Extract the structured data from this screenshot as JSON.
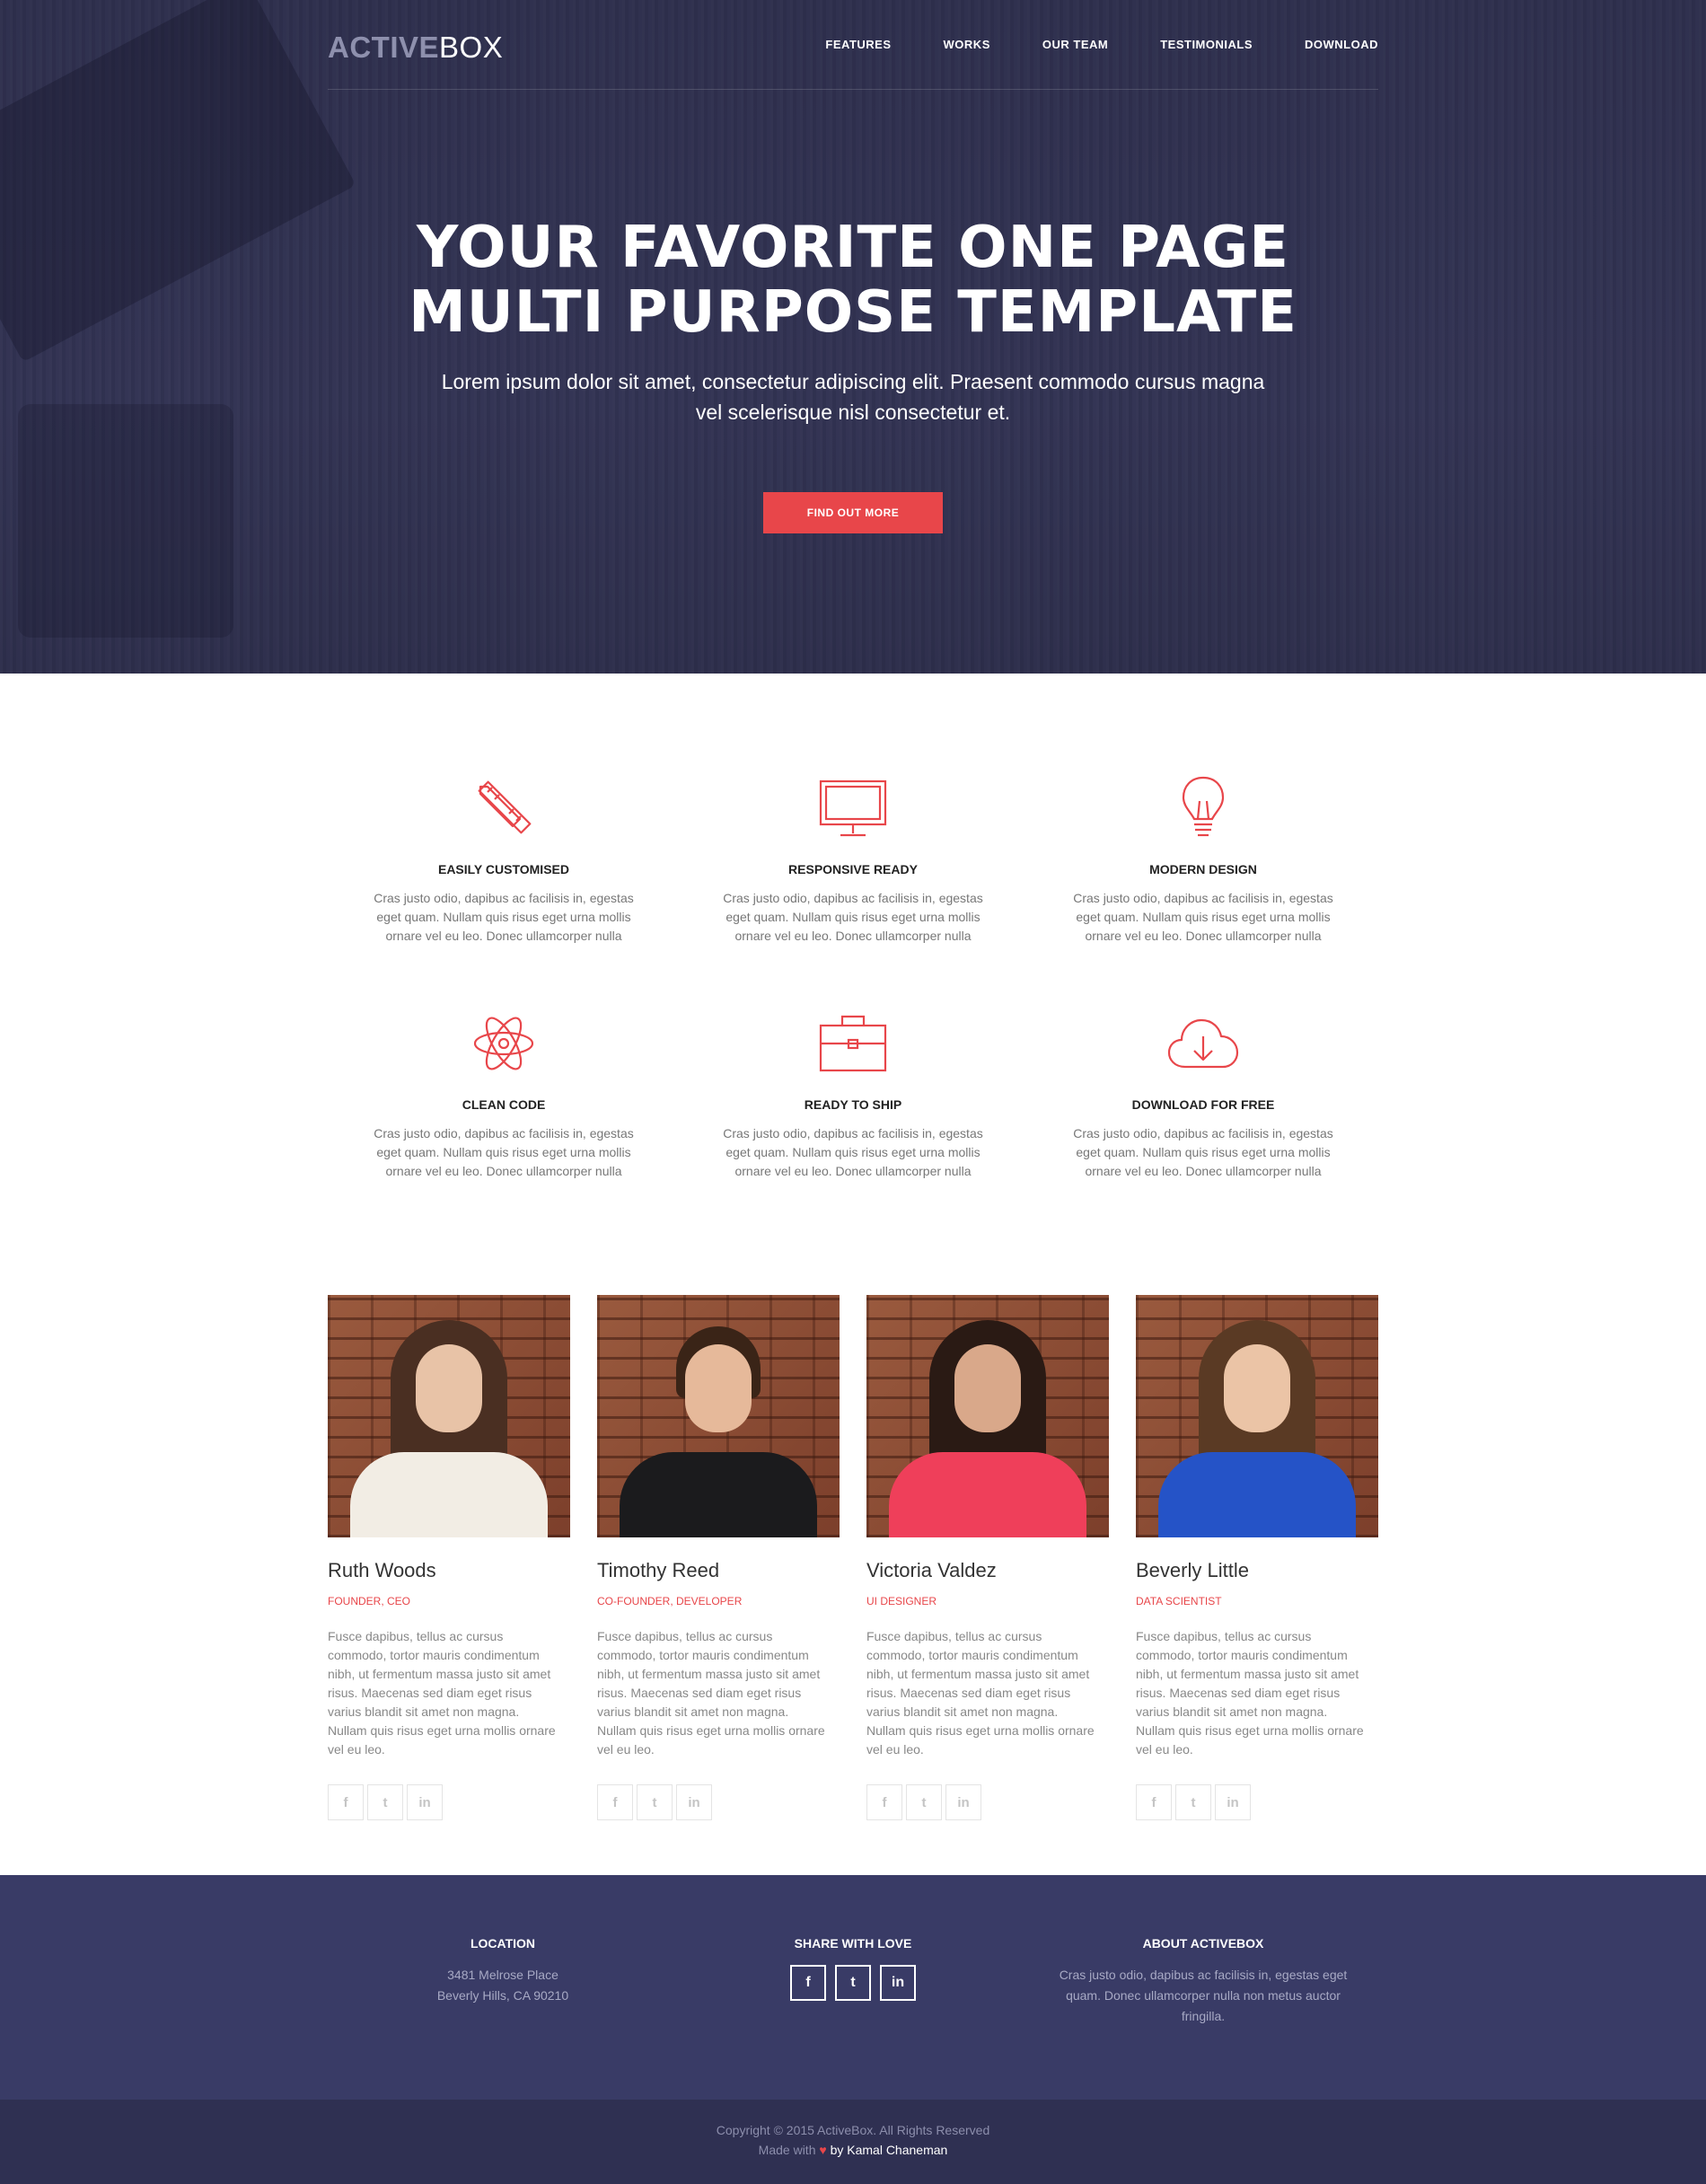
{
  "brand": {
    "strong": "ACTIVE",
    "light": "BOX"
  },
  "nav": {
    "items": [
      "FEATURES",
      "WORKS",
      "OUR TEAM",
      "TESTIMONIALS",
      "DOWNLOAD"
    ]
  },
  "hero": {
    "title_line1": "YOUR FAVORITE ONE PAGE",
    "title_line2": "MULTI PURPOSE TEMPLATE",
    "subtitle_line1": "Lorem ipsum dolor sit amet, consectetur adipiscing elit. Praesent commodo cursus magna",
    "subtitle_line2": "vel scelerisque nisl consectetur et.",
    "button": "FIND OUT MORE"
  },
  "colors": {
    "accent": "#e8464a",
    "hero_bg": "#2f3050",
    "footer_bg": "#393b66",
    "copyright_bg": "#2f3052"
  },
  "features": [
    {
      "icon": "pencil-ruler-icon",
      "title": "EASILY CUSTOMISED",
      "text_l1": "Cras justo odio, dapibus ac facilisis in, egestas",
      "text_l2": "eget quam. Nullam quis risus eget urna mollis",
      "text_l3": "ornare vel eu leo. Donec ullamcorper nulla"
    },
    {
      "icon": "monitor-icon",
      "title": "RESPONSIVE READY",
      "text_l1": "Cras justo odio, dapibus ac facilisis in, egestas",
      "text_l2": "eget quam. Nullam quis risus eget urna mollis",
      "text_l3": "ornare vel eu leo. Donec ullamcorper nulla"
    },
    {
      "icon": "lightbulb-icon",
      "title": "MODERN DESIGN",
      "text_l1": "Cras justo odio, dapibus ac facilisis in, egestas",
      "text_l2": "eget quam. Nullam quis risus eget urna mollis",
      "text_l3": "ornare vel eu leo. Donec ullamcorper nulla"
    },
    {
      "icon": "atom-icon",
      "title": "CLEAN CODE",
      "text_l1": "Cras justo odio, dapibus ac facilisis in, egestas",
      "text_l2": "eget quam. Nullam quis risus eget urna mollis",
      "text_l3": "ornare vel eu leo. Donec ullamcorper nulla"
    },
    {
      "icon": "briefcase-icon",
      "title": "READY TO SHIP",
      "text_l1": "Cras justo odio, dapibus ac facilisis in, egestas",
      "text_l2": "eget quam. Nullam quis risus eget urna mollis",
      "text_l3": "ornare vel eu leo. Donec ullamcorper nulla"
    },
    {
      "icon": "cloud-download-icon",
      "title": "DOWNLOAD FOR FREE",
      "text_l1": "Cras justo odio, dapibus ac facilisis in, egestas",
      "text_l2": "eget quam. Nullam quis risus eget urna mollis",
      "text_l3": "ornare vel eu leo. Donec ullamcorper nulla"
    }
  ],
  "team": [
    {
      "name": "Ruth Woods",
      "role": "FOUNDER, CEO",
      "bio": [
        "Fusce dapibus, tellus ac cursus",
        "commodo, tortor mauris condimentum",
        "nibh, ut fermentum massa justo sit amet",
        "risus. Maecenas sed diam eget risus",
        "varius blandit sit amet non magna.",
        "Nullam quis risus eget urna mollis ornare",
        "vel eu leo."
      ]
    },
    {
      "name": "Timothy Reed",
      "role": "CO-FOUNDER, DEVELOPER",
      "bio": [
        "Fusce dapibus, tellus ac cursus",
        "commodo, tortor mauris condimentum",
        "nibh, ut fermentum massa justo sit amet",
        "risus. Maecenas sed diam eget risus",
        "varius blandit sit amet non magna.",
        "Nullam quis risus eget urna mollis ornare",
        "vel eu leo."
      ]
    },
    {
      "name": "Victoria Valdez",
      "role": "UI DESIGNER",
      "bio": [
        "Fusce dapibus, tellus ac cursus",
        "commodo, tortor mauris condimentum",
        "nibh, ut fermentum massa justo sit amet",
        "risus. Maecenas sed diam eget risus",
        "varius blandit sit amet non magna.",
        "Nullam quis risus eget urna mollis ornare",
        "vel eu leo."
      ]
    },
    {
      "name": "Beverly Little",
      "role": "DATA SCIENTIST",
      "bio": [
        "Fusce dapibus, tellus ac cursus",
        "commodo, tortor mauris condimentum",
        "nibh, ut fermentum massa justo sit amet",
        "risus. Maecenas sed diam eget risus",
        "varius blandit sit amet non magna.",
        "Nullam quis risus eget urna mollis ornare",
        "vel eu leo."
      ]
    }
  ],
  "social_glyphs": {
    "facebook": "f",
    "twitter": "t",
    "linkedin": "in"
  },
  "footer": {
    "location": {
      "title": "LOCATION",
      "line1": "3481 Melrose Place",
      "line2": "Beverly Hills, CA 90210"
    },
    "share": {
      "title": "SHARE WITH LOVE"
    },
    "about": {
      "title": "ABOUT ACTIVEBOX",
      "line1": "Cras justo odio, dapibus ac facilisis in, egestas eget",
      "line2": "quam. Donec ullamcorper nulla non metus auctor",
      "line3": "fringilla."
    }
  },
  "copyright": {
    "line1": "Copyright © 2015 ActiveBox. All Rights Reserved",
    "made_with": "Made with",
    "heart": "♥",
    "by": "by Kamal Chaneman"
  }
}
